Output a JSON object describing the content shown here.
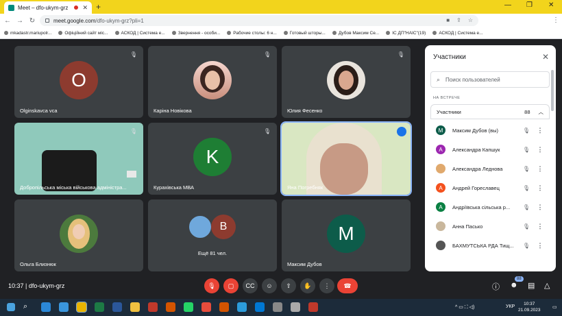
{
  "browser": {
    "tab_title": "Meet – dfo-ukym-grz",
    "url_host": "meet.google.com",
    "url_path": "/dfo-ukym-grz?pli=1",
    "profile_letter": "M"
  },
  "bookmarks": [
    "mkadastr.mariupolr...",
    "Офіційний сайт міс...",
    "АСКОД | Система е...",
    "Звернення - особи...",
    "Рабочие столы: 6 н...",
    "Готовый шторы...",
    "Дубов Максим Се...",
    "ІС ДП\"НАІС\"(19)",
    "АСКОД | Система е..."
  ],
  "tiles": [
    {
      "name": "Olginskavca vca",
      "initial": "O",
      "color": "#8d3b2f"
    },
    {
      "name": "Каріна Новікова"
    },
    {
      "name": "Юлия Фесенко"
    },
    {
      "name": "Добропільська міська військова адміністра..."
    },
    {
      "name": "Курахівська МВА",
      "initial": "K",
      "color": "#1e7e34"
    },
    {
      "name": "Яна Погребняк"
    },
    {
      "name": "Ольга Близнюк"
    },
    {
      "name": "Ещё 81 чел.",
      "initial": "B",
      "color": "#8d3b2f"
    },
    {
      "name": "Максим Дубов",
      "initial": "M",
      "color": "#0d5c4a"
    }
  ],
  "bottom": {
    "time": "10:37",
    "meeting_code": "dfo-ukym-grz",
    "participants_badge": "88"
  },
  "panel": {
    "title": "Участники",
    "search_placeholder": "Поиск пользователей",
    "section": "НА ВСТРЕЧЕ",
    "group_label": "Участники",
    "group_count": "88",
    "people": [
      {
        "name": "Максим Дубов (вы)",
        "initial": "M",
        "color": "#0d5c4a"
      },
      {
        "name": "Александра Капшук",
        "initial": "A",
        "color": "#9c27b0"
      },
      {
        "name": "Александра Леднова",
        "initial": "",
        "color": "#e0a96d"
      },
      {
        "name": "Андрей Гореславец",
        "initial": "A",
        "color": "#f4511e"
      },
      {
        "name": "Андріївська сільська р...",
        "initial": "A",
        "color": "#0b8043"
      },
      {
        "name": "Анна Пасько",
        "initial": "",
        "color": "#c9b79c"
      },
      {
        "name": "БАХМУТСЬКА РДА Тищ...",
        "initial": "",
        "color": "#555555"
      }
    ]
  },
  "taskbar": {
    "lang": "УКР",
    "time": "10:37",
    "date": "21.09.2023"
  }
}
